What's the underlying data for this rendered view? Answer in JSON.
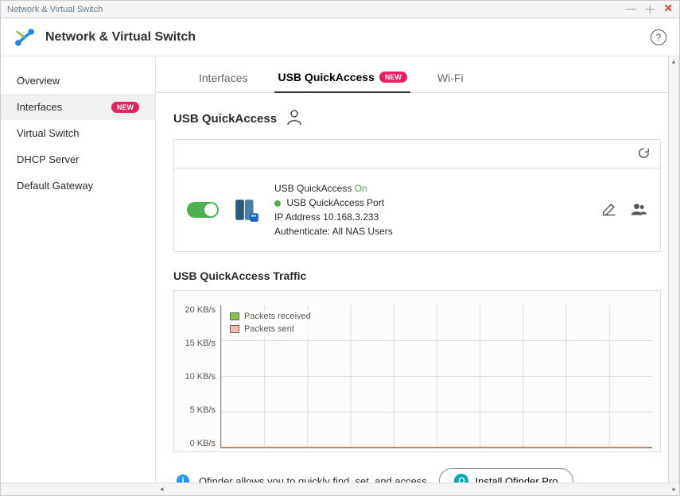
{
  "window": {
    "title": "Network & Virtual Switch"
  },
  "header": {
    "title": "Network & Virtual Switch"
  },
  "sidebar": {
    "items": [
      {
        "label": "Overview",
        "badge": ""
      },
      {
        "label": "Interfaces",
        "badge": "NEW"
      },
      {
        "label": "Virtual Switch",
        "badge": ""
      },
      {
        "label": "DHCP Server",
        "badge": ""
      },
      {
        "label": "Default Gateway",
        "badge": ""
      }
    ]
  },
  "tabs": [
    {
      "label": "Interfaces",
      "badge": ""
    },
    {
      "label": "USB QuickAccess",
      "badge": "NEW"
    },
    {
      "label": "Wi-Fi",
      "badge": ""
    }
  ],
  "section": {
    "title": "USB QuickAccess"
  },
  "device": {
    "name": "USB QuickAccess",
    "status": "On",
    "port_label": "USB QuickAccess Port",
    "ip_label": "IP Address",
    "ip": "10.168.3.233",
    "auth_label": "Authenticate:",
    "auth_value": "All NAS Users"
  },
  "traffic": {
    "title": "USB QuickAccess Traffic"
  },
  "chart_data": {
    "type": "line",
    "title": "USB QuickAccess Traffic",
    "ylabel": "KB/s",
    "ylim": [
      0,
      20
    ],
    "yticks": [
      "20 KB/s",
      "15 KB/s",
      "10 KB/s",
      "5 KB/s",
      "0 KB/s"
    ],
    "series": [
      {
        "name": "Packets received",
        "color": "#8bc34a",
        "values": [
          0,
          0,
          0,
          0,
          0,
          0,
          0,
          0,
          0,
          0
        ]
      },
      {
        "name": "Packets sent",
        "color": "#f8b9b0",
        "values": [
          0,
          0,
          0,
          0,
          0,
          0,
          0,
          0,
          0,
          0
        ]
      }
    ]
  },
  "footer": {
    "hint": "Qfinder allows you to quickly find, set, and access.",
    "button": "Install Qfinder Pro"
  }
}
